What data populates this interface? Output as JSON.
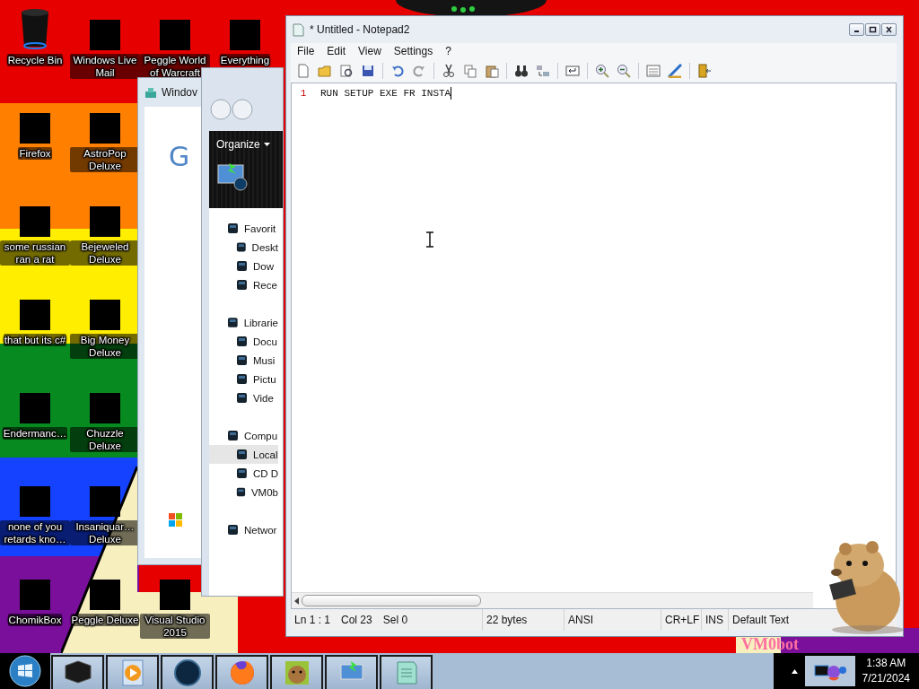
{
  "desktop": {
    "icon_columns": [
      [
        {
          "label": "Recycle Bin",
          "kind": "bin"
        },
        {
          "label": "Firefox",
          "kind": "covered"
        },
        {
          "label": "some russian ran a rat",
          "kind": "covered"
        },
        {
          "label": "that but its c#",
          "kind": "covered"
        },
        {
          "label": "Endermanc…",
          "kind": "covered"
        },
        {
          "label": "none of you retards kno…",
          "kind": "covered"
        },
        {
          "label": "ChomikBox",
          "kind": "covered"
        }
      ],
      [
        {
          "label": "Windows Live Mail",
          "kind": "covered"
        },
        {
          "label": "AstroPop Deluxe",
          "kind": "covered"
        },
        {
          "label": "Bejeweled Deluxe",
          "kind": "covered"
        },
        {
          "label": "Big Money Deluxe",
          "kind": "covered"
        },
        {
          "label": "Chuzzle Deluxe",
          "kind": "covered"
        },
        {
          "label": "Insaniquar… Deluxe",
          "kind": "covered"
        },
        {
          "label": "Peggle Deluxe",
          "kind": "covered"
        }
      ],
      [
        {
          "label": "Peggle World of Warcraft",
          "kind": "covered"
        },
        {
          "label": "Visual Studio 2015",
          "kind": "covered"
        }
      ],
      [
        {
          "label": "Everything",
          "kind": "covered"
        }
      ]
    ],
    "wallpaper_text": "VM0bot"
  },
  "browser_window": {
    "title": "Windov",
    "logo_letter": "G"
  },
  "explorer_window": {
    "organize": "Organize",
    "nav": [
      {
        "label": "Favorit",
        "selected": false,
        "children": [
          {
            "label": "Deskt",
            "selected": false
          },
          {
            "label": "Dow",
            "selected": false
          },
          {
            "label": "Rece",
            "selected": false
          }
        ]
      },
      {
        "label": "Librarie",
        "selected": false,
        "children": [
          {
            "label": "Docu",
            "selected": false
          },
          {
            "label": "Musi",
            "selected": false
          },
          {
            "label": "Pictu",
            "selected": false
          },
          {
            "label": "Vide",
            "selected": false
          }
        ]
      },
      {
        "label": "Compu",
        "selected": false,
        "children": [
          {
            "label": "Local",
            "selected": true
          },
          {
            "label": "CD D",
            "selected": false
          },
          {
            "label": "VM0b",
            "selected": false
          }
        ]
      },
      {
        "label": "Networ",
        "selected": false
      }
    ]
  },
  "notepad": {
    "title": "* Untitled - Notepad2",
    "menu": [
      "File",
      "Edit",
      "View",
      "Settings",
      "?"
    ],
    "lines": [
      {
        "number": "1",
        "text": "RUN SETUP EXE FR INSTA"
      }
    ],
    "status": {
      "position": "Ln 1 : 1",
      "column": "Col 23",
      "selection": "Sel 0",
      "size": "22 bytes",
      "encoding": "ANSI",
      "line_endings": "CR+LF",
      "mode": "INS",
      "scheme": "Default Text"
    }
  },
  "taskbar": {
    "time": "1:38 AM",
    "date": "7/21/2024"
  }
}
